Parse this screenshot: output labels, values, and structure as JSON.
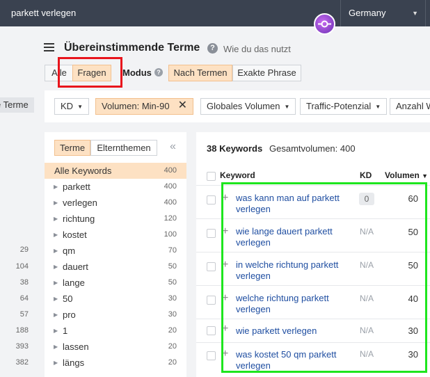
{
  "topbar": {
    "search_value": "parkett verlegen",
    "country": "Germany"
  },
  "header": {
    "title": "Übereinstimmende Terme",
    "help_link": "Wie du das nutzt"
  },
  "mode": {
    "type_options": [
      "Alle",
      "Fragen"
    ],
    "type_selected": "Fragen",
    "label": "Modus",
    "match_options": [
      "Nach Termen",
      "Exakte Phrase"
    ],
    "match_selected": "Nach Termen"
  },
  "left_edge": {
    "tag": "Terme",
    "numbers": [
      "29",
      "104",
      "38",
      "64",
      "57",
      "188",
      "393",
      "382"
    ]
  },
  "filters": {
    "kd": "KD",
    "volume": "Volumen: Min-90",
    "global_volume": "Globales Volumen",
    "traffic": "Traffic-Potenzial",
    "count": "Anzahl W"
  },
  "terms_panel": {
    "tabs": [
      "Terme",
      "Elternthemen"
    ],
    "active_tab": "Terme",
    "rows": [
      {
        "term": "Alle Keywords",
        "count": "400"
      },
      {
        "term": "parkett",
        "count": "400"
      },
      {
        "term": "verlegen",
        "count": "400"
      },
      {
        "term": "richtung",
        "count": "120"
      },
      {
        "term": "kostet",
        "count": "100"
      },
      {
        "term": "qm",
        "count": "70"
      },
      {
        "term": "dauert",
        "count": "50"
      },
      {
        "term": "lange",
        "count": "50"
      },
      {
        "term": "50",
        "count": "30"
      },
      {
        "term": "pro",
        "count": "30"
      },
      {
        "term": "1",
        "count": "20"
      },
      {
        "term": "lassen",
        "count": "20"
      },
      {
        "term": "längs",
        "count": "20"
      }
    ]
  },
  "keywords_panel": {
    "count_label": "38 Keywords",
    "total_volume": "Gesamtvolumen: 400",
    "columns": {
      "keyword": "Keyword",
      "kd": "KD",
      "volume": "Volumen"
    },
    "rows": [
      {
        "keyword": "was kann man auf parkett verlegen",
        "kd": "0",
        "volume": "60"
      },
      {
        "keyword": "wie lange dauert parkett verlegen",
        "kd": "N/A",
        "volume": "50"
      },
      {
        "keyword": "in welche richtung parkett verlegen",
        "kd": "N/A",
        "volume": "50"
      },
      {
        "keyword": "welche richtung parkett verlegen",
        "kd": "N/A",
        "volume": "40"
      },
      {
        "keyword": "wie parkett verlegen",
        "kd": "N/A",
        "volume": "30"
      },
      {
        "keyword": "was kostet 50 qm parkett verlegen",
        "kd": "N/A",
        "volume": "30"
      }
    ]
  },
  "colors": {
    "topbar": "#3a4250",
    "active_fill": "#fde1c3",
    "link": "#1f4ea1",
    "highlight_red": "#e8141c",
    "highlight_green": "#1ee61e"
  }
}
